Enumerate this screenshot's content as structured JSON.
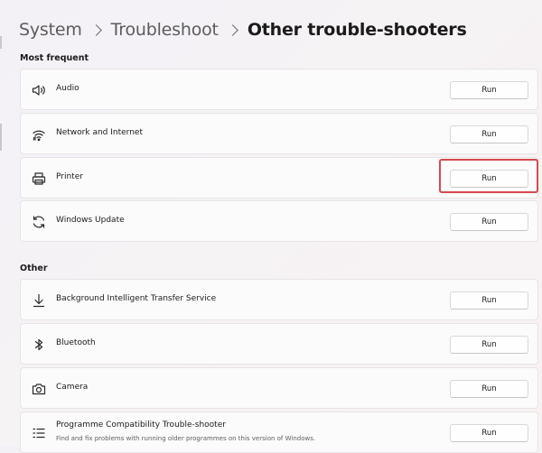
{
  "breadcrumb": {
    "items": [
      "System",
      "Troubleshoot",
      "Other trouble-shooters"
    ]
  },
  "sections": {
    "most_frequent": {
      "title": "Most frequent",
      "items": [
        {
          "label": "Audio",
          "icon": "speaker-icon",
          "button": "Run"
        },
        {
          "label": "Network and Internet",
          "icon": "wifi-icon",
          "button": "Run"
        },
        {
          "label": "Printer",
          "icon": "printer-icon",
          "button": "Run"
        },
        {
          "label": "Windows Update",
          "icon": "refresh-icon",
          "button": "Run"
        }
      ]
    },
    "other": {
      "title": "Other",
      "items": [
        {
          "label": "Background Intelligent Transfer Service",
          "icon": "download-icon",
          "button": "Run"
        },
        {
          "label": "Bluetooth",
          "icon": "bluetooth-icon",
          "button": "Run"
        },
        {
          "label": "Camera",
          "icon": "camera-icon",
          "button": "Run"
        },
        {
          "label": "Programme Compatibility Trouble-shooter",
          "description": "Find and fix problems with running older programmes on this version of Windows.",
          "icon": "compatibility-list-icon",
          "button": "Run"
        }
      ]
    }
  },
  "highlight_color": "#d5484f"
}
